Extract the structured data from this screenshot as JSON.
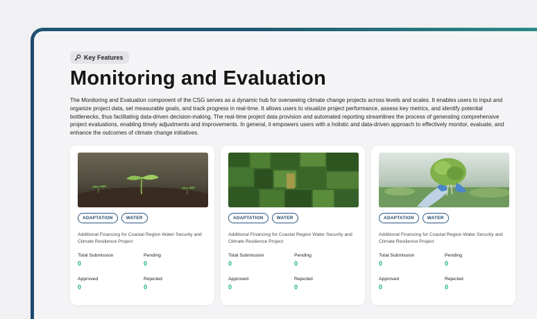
{
  "badge": {
    "icon": "key-icon",
    "label": "Key Features"
  },
  "title": "Monitoring and Evaluation",
  "description": "The Monitoring and Evaluation component of the CSG serves as a dynamic hub for overseeing climate change projects across levels and scales. It enables users to input and organize project data, set measurable goals, and track progress in real-time. It allows users to visualize project performance, assess key metrics, and identify potential bottlenecks, thus facilitating data-driven decision-making. The real-time project data provision and automated reporting streamlines the process of generating comprehensive project evaluations, enabling timely adjustments and improvements. In general, it empowers users with a holistic and data-driven approach to effectively monitor, evaluate, and enhance the outcomes of climate change initiatives.",
  "colors": {
    "accent": "#1f4a6e",
    "value": "#1bb18a"
  },
  "cards": [
    {
      "image": "seedling-photo",
      "tags": [
        "ADAPTATION",
        "WATER"
      ],
      "project": "Additional Financing for Coastal Region Water Security and Climate Resilience Project",
      "stats": {
        "total_label": "Total Submission",
        "total": "0",
        "pending_label": "Pending",
        "pending": "0",
        "approved_label": "Approved",
        "approved": "0",
        "rejected_label": "Rejected",
        "rejected": "0"
      }
    },
    {
      "image": "aerial-farmland-photo",
      "tags": [
        "ADAPTATION",
        "WATER"
      ],
      "project": "Additional Financing for Coastal Region Water Security and Climate Resilience Project",
      "stats": {
        "total_label": "Total Submission",
        "total": "0",
        "pending_label": "Pending",
        "pending": "0",
        "approved_label": "Approved",
        "approved": "0",
        "rejected_label": "Rejected",
        "rejected": "0"
      }
    },
    {
      "image": "hydroponic-lettuce-photo",
      "tags": [
        "ADAPTATION",
        "WATER"
      ],
      "project": "Additional Financing for Coastal Region Water Security and Climate Resilience Project",
      "stats": {
        "total_label": "Total Submission",
        "total": "0",
        "pending_label": "Pending",
        "pending": "0",
        "approved_label": "Approved",
        "approved": "0",
        "rejected_label": "Rejected",
        "rejected": "0"
      }
    }
  ]
}
